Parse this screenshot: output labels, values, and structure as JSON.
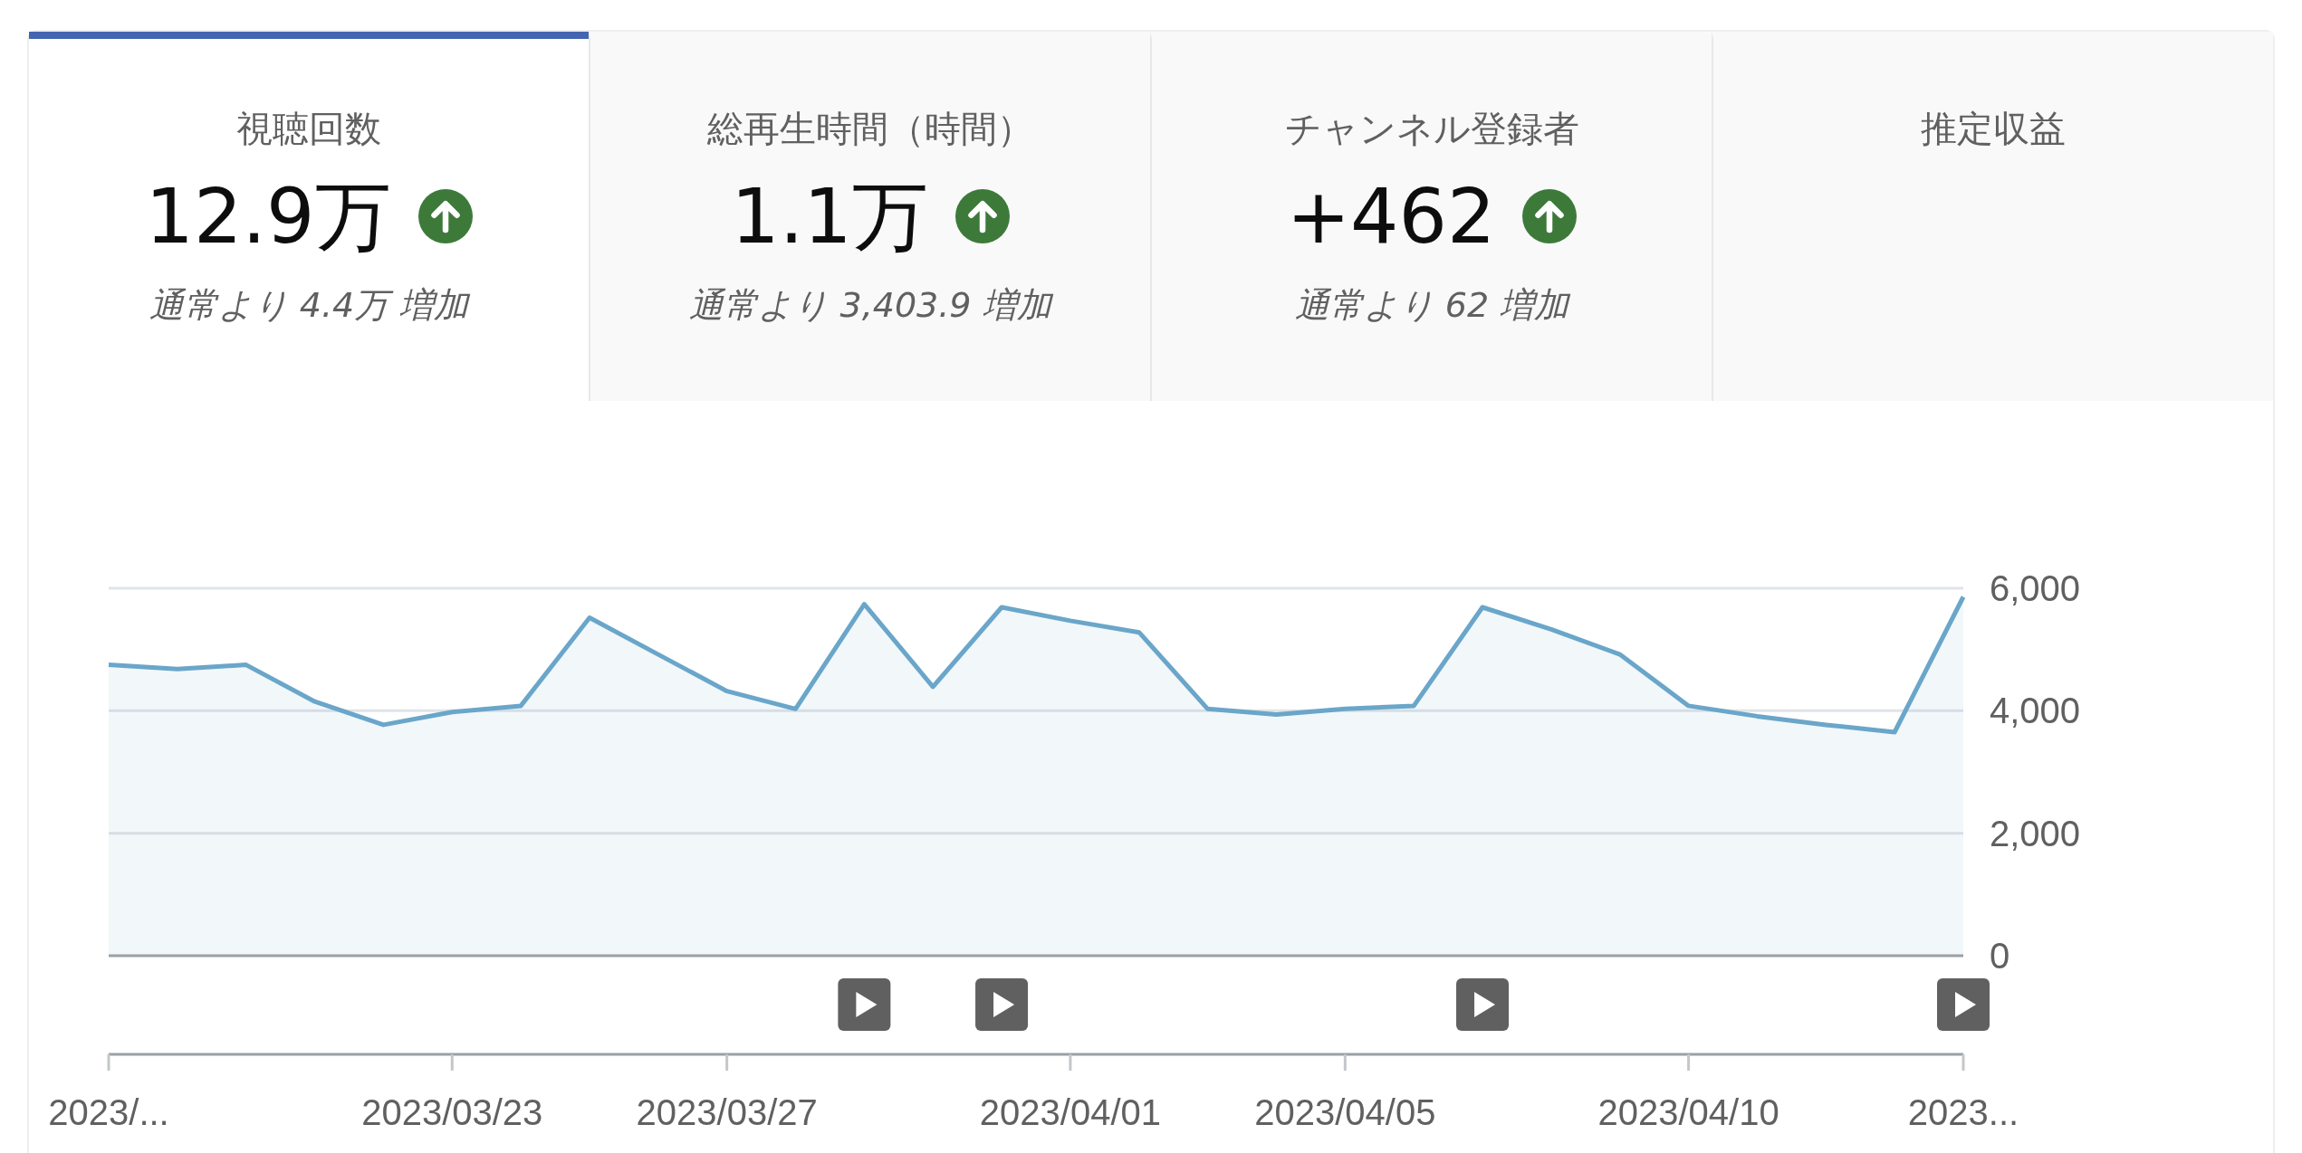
{
  "metric_tabs": [
    {
      "title": "視聴回数",
      "value": "12.9万",
      "rising": true,
      "comparison": "通常より 4.4万 増加",
      "selected": true
    },
    {
      "title": "総再生時間（時間）",
      "value": "1.1万",
      "rising": true,
      "comparison": "通常より 3,403.9 増加",
      "selected": false
    },
    {
      "title": "チャンネル登録者",
      "value": "+462",
      "rising": true,
      "comparison": "通常より 62 増加",
      "selected": false
    },
    {
      "title": "推定収益",
      "selected": false
    }
  ],
  "chart": {
    "chart_data": {
      "type": "area",
      "categories": [
        "2023/...",
        null,
        null,
        null,
        null,
        "2023/03/23",
        null,
        null,
        null,
        "2023/03/27",
        null,
        null,
        null,
        null,
        "2023/04/01",
        null,
        null,
        null,
        "2023/04/05",
        null,
        null,
        null,
        null,
        "2023/04/10",
        null,
        null,
        null,
        "2023..."
      ],
      "series": [
        {
          "color": "#6aa6c9",
          "values": [
            4750,
            4680,
            4750,
            4150,
            3770,
            3980,
            4080,
            5520,
            4920,
            4320,
            4030,
            5740,
            4390,
            5690,
            5470,
            5280,
            4030,
            3940,
            4030,
            4080,
            5690,
            5330,
            4920,
            4080,
            3910,
            3770,
            3650,
            5860
          ]
        }
      ],
      "ylim": [
        0,
        6000
      ],
      "yticks": [
        {
          "value": 0,
          "label": "0"
        },
        {
          "value": 2000,
          "label": "2,000"
        },
        {
          "value": 4000,
          "label": "4,000"
        },
        {
          "value": 6000,
          "label": "6,000"
        }
      ]
    },
    "video_row": [
      {
        "video": false
      },
      {
        "video": false
      },
      {
        "video": false
      },
      {
        "video": false
      },
      {
        "video": false
      },
      {
        "video": false
      },
      {
        "video": false
      },
      {
        "video": false
      },
      {
        "video": false
      },
      {
        "video": false
      },
      {
        "video": false
      },
      {
        "video": true
      },
      {
        "video": false
      },
      {
        "video": true
      },
      {
        "video": false
      },
      {
        "video": false
      },
      {
        "video": false
      },
      {
        "video": false
      },
      {
        "video": false
      },
      {
        "video": false
      },
      {
        "video": true
      },
      {
        "video": false
      },
      {
        "video": false
      },
      {
        "video": false
      },
      {
        "video": false
      },
      {
        "video": false
      },
      {
        "video": false
      },
      {
        "video": true
      }
    ]
  }
}
